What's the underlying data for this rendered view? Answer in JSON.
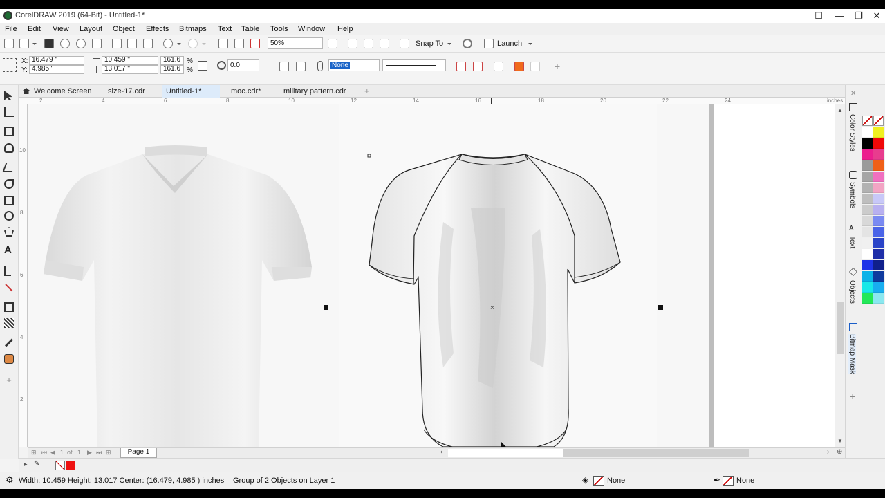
{
  "window": {
    "title": "CorelDRAW 2019 (64-Bit) - Untitled-1*",
    "minimize": "—",
    "restore": "❐",
    "close": "✕"
  },
  "menu": [
    "File",
    "Edit",
    "View",
    "Layout",
    "Object",
    "Effects",
    "Bitmaps",
    "Text",
    "Table",
    "Tools",
    "Window",
    "Help"
  ],
  "toolbar": {
    "zoom": "50%",
    "snap_label": "Snap To",
    "launch_label": "Launch"
  },
  "properties": {
    "x_label": "X:",
    "x": "16.479 \"",
    "y_label": "Y:",
    "y": "4.985 \"",
    "width": "10.459 \"",
    "height": "13.017 \"",
    "scale_x": "161.6",
    "scale_y": "161.6",
    "percent": "%",
    "rotation": "0.0",
    "outline": "None"
  },
  "tabs": [
    {
      "label": "Welcome Screen",
      "active": false
    },
    {
      "label": "size-17.cdr",
      "active": false
    },
    {
      "label": "Untitled-1*",
      "active": true
    },
    {
      "label": "moc.cdr*",
      "active": false
    },
    {
      "label": "military pattern.cdr",
      "active": false
    }
  ],
  "ruler": {
    "units": "inches",
    "h_ticks": [
      "2",
      "4",
      "6",
      "8",
      "10",
      "12",
      "14",
      "16",
      "18",
      "20",
      "22",
      "24"
    ],
    "v_ticks": [
      "10",
      "8",
      "6",
      "4",
      "2"
    ]
  },
  "page_nav": {
    "current": "1",
    "of": "of",
    "total": "1",
    "page_label": "Page 1"
  },
  "dockers": [
    "Color Styles",
    "Symbols",
    "Text",
    "Objects",
    "Bitmap Mask"
  ],
  "palette": [
    "#ffffff",
    "#000000",
    "#ec1e8e",
    "#9a9a9a",
    "#a5a5a5",
    "#b2b2b2",
    "#bebebe",
    "#cbcbcb",
    "#d8d8d8",
    "#e4e4e4",
    "#f0f0f0",
    "#ffffff",
    "#1e33e8",
    "#0ab2e8",
    "#18e8e8",
    "#22e858",
    "#f0f020",
    "#f00808",
    "#e83c8e",
    "#f06018",
    "#f070c0",
    "#f2a4c4",
    "#c8c8f8",
    "#b8b0f0",
    "#7a8af2",
    "#4a64e8",
    "#2a44c8",
    "#1e2ea8",
    "#10208c",
    "#0f3a9e",
    "#18aef0",
    "#8ae8f0"
  ],
  "status": {
    "dimensions": "Width: 10.459  Height: 13.017  Center: (16.479, 4.985 )  inches",
    "selection": "Group of 2 Objects on Layer 1",
    "fill": "None",
    "outline": "None"
  }
}
